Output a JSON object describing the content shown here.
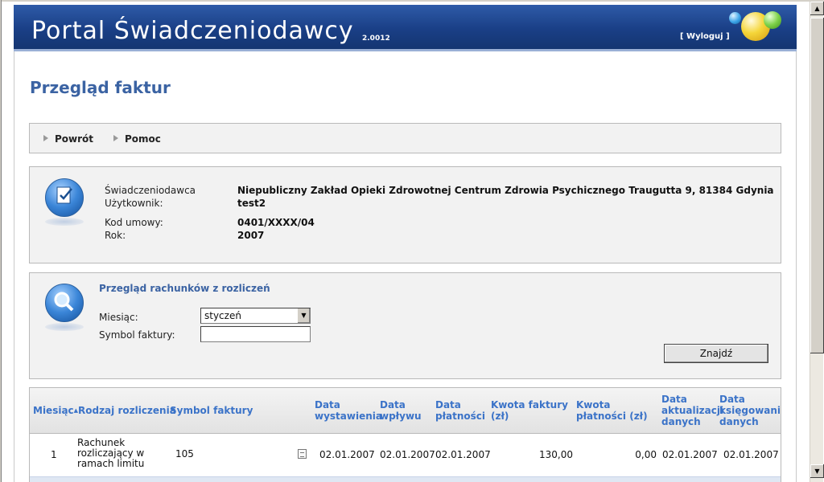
{
  "header": {
    "title": "Portal Świadczeniodawcy",
    "version": "2.0012",
    "logout_label": "[ Wyloguj ]"
  },
  "page_title": "Przegląd faktur",
  "nav": {
    "back_label": "Powrót",
    "help_label": "Pomoc"
  },
  "info": {
    "provider_label": "Świadczeniodawca",
    "provider_value": "Niepubliczny Zakład Opieki Zdrowotnej Centrum Zdrowia Psychicznego Traugutta 9, 81384 Gdynia",
    "user_label": "Użytkownik:",
    "user_value": "test2",
    "contract_label": "Kod umowy:",
    "contract_value": "0401/XXXX/04",
    "year_label": "Rok:",
    "year_value": "2007"
  },
  "search": {
    "title": "Przegląd rachunków z rozliczeń",
    "month_label": "Miesiąc:",
    "month_value": "styczeń",
    "invoice_symbol_label": "Symbol faktury:",
    "invoice_symbol_value": "",
    "find_button": "Znajdź"
  },
  "table": {
    "headers": {
      "month": "Miesiąc",
      "settlement_type": "Rodzaj rozliczenia",
      "invoice_symbol": "Symbol faktury",
      "issue_date": "Data wystawienia",
      "receipt_date": "Data wpływu",
      "payment_date": "Data płatności",
      "invoice_amount": "Kwota faktury (zł)",
      "payment_amount": "Kwota płatności (zł)",
      "update_date": "Data aktualizacji danych",
      "posting_date": "Data księgowania danych"
    },
    "rows": [
      {
        "month": "1",
        "settlement_type": "Rachunek rozliczający w ramach limitu",
        "invoice_symbol": "105",
        "issue_date": "02.01.2007",
        "receipt_date": "02.01.2007",
        "payment_date": "02.01.2007",
        "invoice_amount": "130,00",
        "payment_amount": "0,00",
        "update_date": "02.01.2007",
        "posting_date": "02.01.2007"
      }
    ]
  },
  "colors": {
    "banner": "#1a3f86",
    "title_blue": "#3b63a3",
    "header_link": "#3b73c8",
    "panel_bg": "#f2f2f2"
  }
}
